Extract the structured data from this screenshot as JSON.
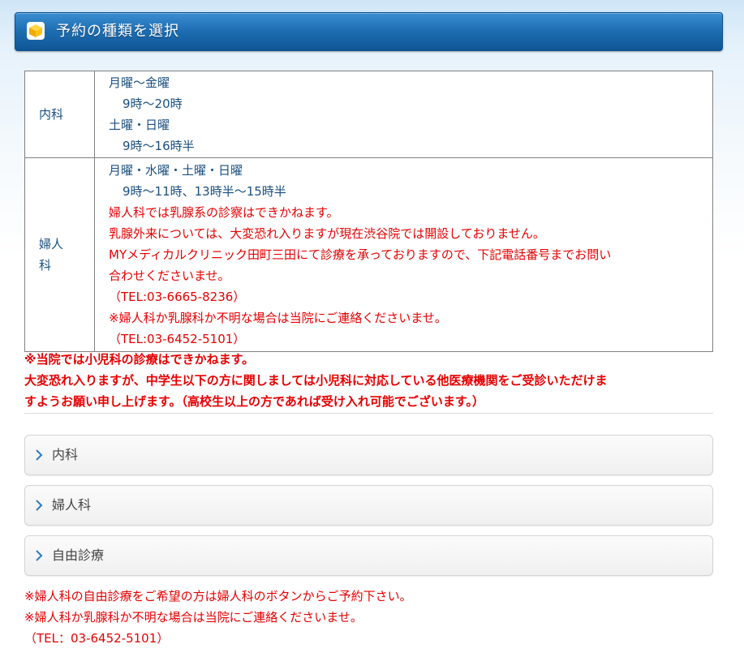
{
  "header": {
    "icon": "box-icon",
    "title": "予約の種類を選択"
  },
  "schedule": [
    {
      "dept": "内科",
      "lines": [
        {
          "text": "月曜～金曜",
          "color": "blue",
          "indent": false
        },
        {
          "text": "9時～20時",
          "color": "blue",
          "indent": true
        },
        {
          "text": "土曜・日曜",
          "color": "blue",
          "indent": false
        },
        {
          "text": "9時～16時半",
          "color": "blue",
          "indent": true
        }
      ]
    },
    {
      "dept_line1": "婦人",
      "dept_line2": "科",
      "lines": [
        {
          "text": "月曜・水曜・土曜・日曜",
          "color": "blue",
          "indent": false
        },
        {
          "text": "9時～11時、13時半～15時半",
          "color": "blue",
          "indent": true
        },
        {
          "text": "婦人科では乳腺系の診察はできかねます。",
          "color": "red",
          "indent": false
        },
        {
          "text": "乳腺外来については、大変恐れ入りますが現在渋谷院では開設しておりません。",
          "color": "red",
          "indent": false
        },
        {
          "text": "MYメディカルクリニック田町三田にて診療を承っておりますので、下記電話番号までお問い",
          "color": "red",
          "indent": false
        },
        {
          "text": "合わせくださいませ。",
          "color": "red",
          "indent": false
        },
        {
          "text": "（TEL:03-6665-8236）",
          "color": "red",
          "indent": false
        },
        {
          "text": "※婦人科か乳腺科か不明な場合は当院にご連絡くださいませ。",
          "color": "red",
          "indent": false
        },
        {
          "text": "（TEL:03-6452-5101）",
          "color": "red",
          "indent": false
        }
      ]
    }
  ],
  "notice": {
    "line1": "※当院では小児科の診療はできかねます。",
    "line2": "大変恐れ入りますが、中学生以下の方に関しましては小児科に対応している他医療機関をご受診いただけま",
    "line3": "すようお願い申し上げます。（高校生以上の方であれば受け入れ可能でございます。）"
  },
  "accordion": [
    {
      "label": "内科"
    },
    {
      "label": "婦人科"
    },
    {
      "label": "自由診療"
    }
  ],
  "footnote": {
    "line1": "※婦人科の自由診療をご希望の方は婦人科のボタンからご予約下さい。",
    "line2": "※婦人科か乳腺科か不明な場合は当院にご連絡くださいませ。",
    "line3": "（TEL：03-6452-5101）"
  },
  "colors": {
    "header_blue": "#1f6fb4",
    "text_blue": "#1a4f80",
    "alert_red": "#e60000",
    "chevron_blue": "#2a7dc4"
  }
}
